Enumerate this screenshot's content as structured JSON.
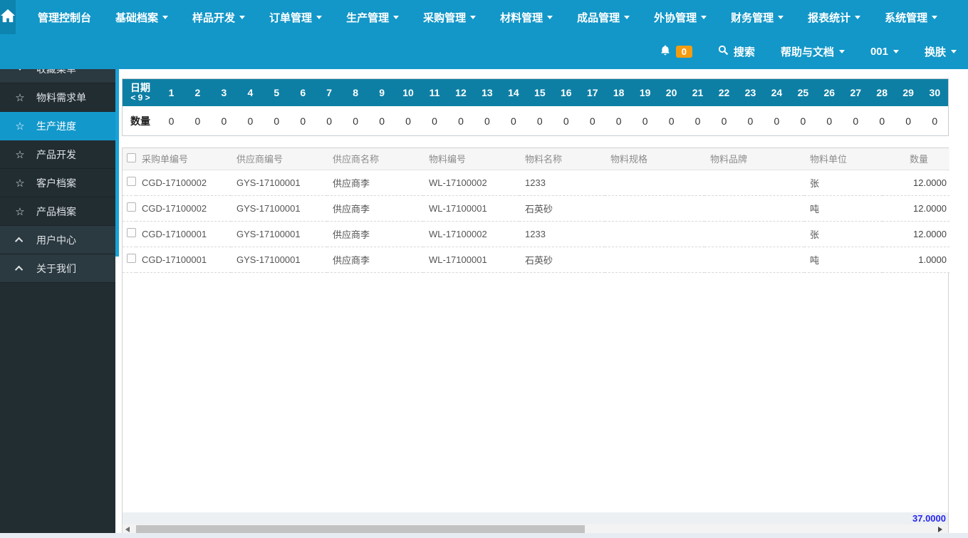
{
  "header": {
    "nav_items": [
      {
        "label": "管理控制台",
        "caret": false
      },
      {
        "label": "基础档案",
        "caret": true
      },
      {
        "label": "样品开发",
        "caret": true
      },
      {
        "label": "订单管理",
        "caret": true
      },
      {
        "label": "生产管理",
        "caret": true
      },
      {
        "label": "采购管理",
        "caret": true
      },
      {
        "label": "材料管理",
        "caret": true
      },
      {
        "label": "成品管理",
        "caret": true
      },
      {
        "label": "外协管理",
        "caret": true
      },
      {
        "label": "财务管理",
        "caret": true
      },
      {
        "label": "报表统计",
        "caret": true
      },
      {
        "label": "系统管理",
        "caret": true
      }
    ],
    "utilities": {
      "notification_count": "0",
      "search_label": "搜索",
      "help_label": "帮助与文档",
      "user_label": "001",
      "skin_label": "换肤"
    }
  },
  "sidebar": {
    "items": [
      {
        "label": "收藏菜单",
        "icon": "caret-down",
        "type": "parent",
        "active": false
      },
      {
        "label": "物料需求单",
        "icon": "star",
        "type": "child",
        "active": false
      },
      {
        "label": "生产进度",
        "icon": "star",
        "type": "child",
        "active": true
      },
      {
        "label": "产品开发",
        "icon": "star",
        "type": "child",
        "active": false
      },
      {
        "label": "客户档案",
        "icon": "star",
        "type": "child",
        "active": false
      },
      {
        "label": "产品档案",
        "icon": "star",
        "type": "child",
        "active": false
      },
      {
        "label": "用户中心",
        "icon": "chevron-up",
        "type": "parent",
        "active": false
      },
      {
        "label": "关于我们",
        "icon": "chevron-up",
        "type": "parent",
        "active": false
      }
    ]
  },
  "date_strip": {
    "label": "日期",
    "pager": "< 9 >",
    "days": [
      1,
      2,
      3,
      4,
      5,
      6,
      7,
      8,
      9,
      10,
      11,
      12,
      13,
      14,
      15,
      16,
      17,
      18,
      19,
      20,
      21,
      22,
      23,
      24,
      25,
      26,
      27,
      28,
      29,
      30
    ],
    "qty_label": "数量",
    "quantities": [
      0,
      0,
      0,
      0,
      0,
      0,
      0,
      0,
      0,
      0,
      0,
      0,
      0,
      0,
      0,
      0,
      0,
      0,
      0,
      0,
      0,
      0,
      0,
      0,
      0,
      0,
      0,
      0,
      0,
      0
    ]
  },
  "table": {
    "columns": [
      "采购单编号",
      "供应商编号",
      "供应商名称",
      "物料编号",
      "物料名称",
      "物料规格",
      "物料品牌",
      "物料单位",
      "数量"
    ],
    "rows": [
      [
        "CGD-17100002",
        "GYS-17100001",
        "供应商李",
        "WL-17100002",
        "1233",
        "",
        "",
        "张",
        "12.0000"
      ],
      [
        "CGD-17100002",
        "GYS-17100001",
        "供应商李",
        "WL-17100001",
        "石英砂",
        "",
        "",
        "吨",
        "12.0000"
      ],
      [
        "CGD-17100001",
        "GYS-17100001",
        "供应商李",
        "WL-17100002",
        "1233",
        "",
        "",
        "张",
        "12.0000"
      ],
      [
        "CGD-17100001",
        "GYS-17100001",
        "供应商李",
        "WL-17100001",
        "石英砂",
        "",
        "",
        "吨",
        "1.0000"
      ]
    ],
    "total": "37.0000"
  },
  "colors": {
    "header_blue": "#1297c8",
    "home_tile_blue": "#0d83b0",
    "date_header_blue": "#0e7fa4",
    "active_item_blue": "#1398cb",
    "badge_orange": "#f39c12",
    "total_blue": "#2525f0",
    "sidebar_dark": "#222d32"
  }
}
